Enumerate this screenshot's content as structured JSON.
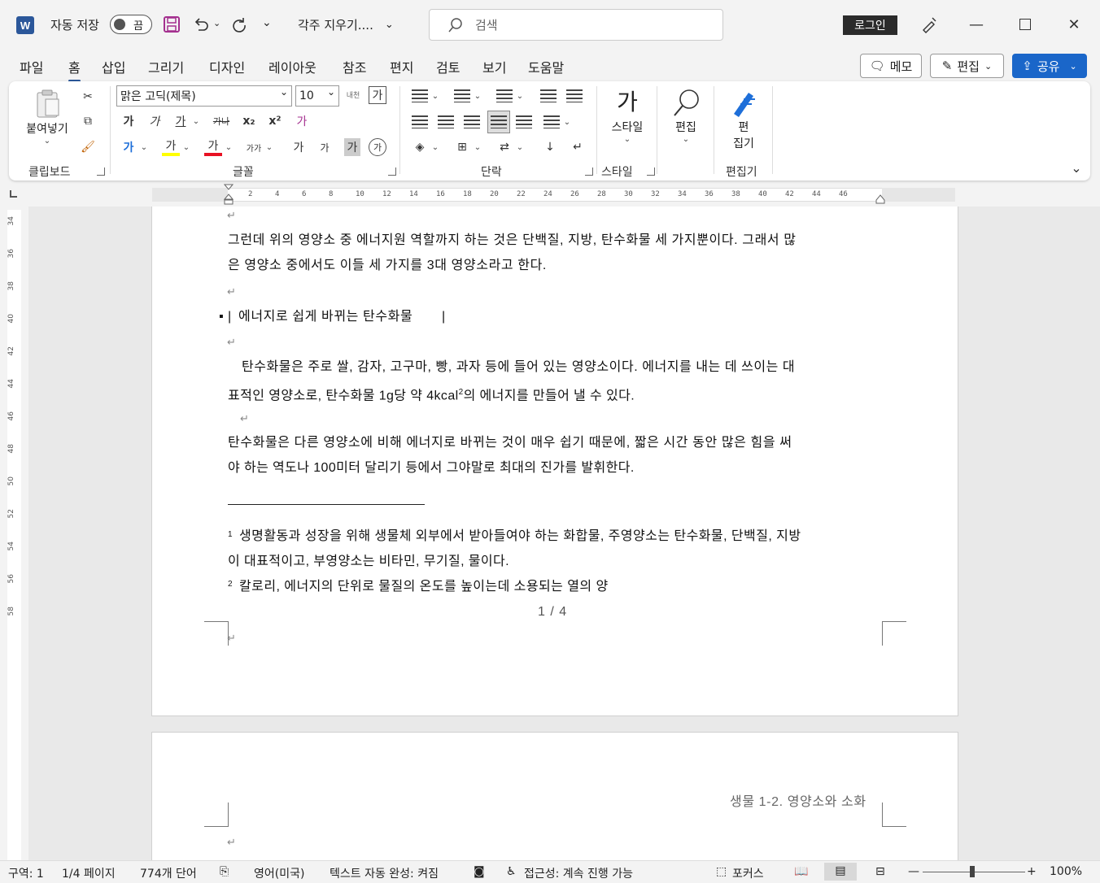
{
  "titlebar": {
    "autosave_label": "자동 저장",
    "autosave_state": "끔",
    "document_title": "각주 지우기....",
    "search_placeholder": "검색",
    "login_label": "로그인"
  },
  "menu": {
    "tabs": [
      "파일",
      "홈",
      "삽입",
      "그리기",
      "디자인",
      "레이아웃",
      "참조",
      "편지",
      "검토",
      "보기",
      "도움말"
    ],
    "active_tab": "홈",
    "memo_label": "메모",
    "edit_label": "편집",
    "share_label": "공유"
  },
  "ribbon": {
    "clipboard": {
      "paste_label": "붙여넣기",
      "group_label": "클립보드"
    },
    "font": {
      "font_name": "맑은 고딕(제목)",
      "font_size": "10",
      "phonetic_label": "내천",
      "char_label": "가",
      "bold": "가",
      "italic": "가",
      "underline": "가",
      "strike": "가나",
      "subscript": "x₂",
      "superscript": "x²",
      "clear_format": "가",
      "text_effect": "가",
      "highlight": "가",
      "font_color": "가",
      "char_spacing": "가가",
      "grow": "가",
      "shrink": "가",
      "shading": "가",
      "enclose": "가",
      "group_label": "글꼴"
    },
    "paragraph": {
      "group_label": "단락"
    },
    "styles": {
      "button_label": "스타일",
      "button_glyph": "가",
      "group_label": "스타일"
    },
    "editing": {
      "button_label": "편집"
    },
    "editor": {
      "button_label_1": "편",
      "button_label_2": "집기",
      "group_label": "편집기"
    }
  },
  "ruler": {
    "h_ticks": [
      "2",
      "4",
      "6",
      "8",
      "10",
      "12",
      "14",
      "16",
      "18",
      "20",
      "22",
      "24",
      "26",
      "28",
      "30",
      "32",
      "34",
      "36",
      "38",
      "40",
      "42",
      "44",
      "46"
    ],
    "v_ticks": [
      "34",
      "36",
      "38",
      "40",
      "42",
      "44",
      "46",
      "48",
      "50",
      "52",
      "54",
      "56",
      "58"
    ]
  },
  "document": {
    "para1_line1": "그런데 위의 영양소 중 에너지원 역할까지 하는 것은 단백질, 지방, 탄수화물 세 가지뿐이다. 그래서 많",
    "para1_line2": "은 영양소 중에서도 이들 세 가지를 3대 영양소라고 한다.",
    "heading": "에너지로 쉽게 바뀌는 탄수화물",
    "para2_line1": "탄수화물은 주로 쌀, 감자, 고구마, 빵, 과자 등에 들어 있는 영양소이다. 에너지를 내는 데 쓰이는 대",
    "para2_line2a": "표적인 영양소로, 탄수화물 1g당 약 4kcal",
    "para2_sup": "2",
    "para2_line2b": "의 에너지를 만들어 낼 수 있다.",
    "para3_line1": "탄수화물은 다른 영양소에 비해 에너지로 바뀌는 것이 매우 쉽기 때문에, 짧은 시간 동안 많은 힘을 써",
    "para3_line2": "야 하는 역도나 100미터 달리기 등에서 그야말로 최대의 진가를 발휘한다.",
    "footnote1_num": "1",
    "footnote1_line1": "생명활동과 성장을 위해 생물체 외부에서 받아들여야 하는 화합물, 주영양소는 탄수화물, 단백질, 지방",
    "footnote1_line2": "이 대표적이고, 부영양소는 비타민, 무기질, 물이다.",
    "footnote2_num": "2",
    "footnote2_text": "칼로리, 에너지의 단위로 물질의 온도를 높이는데 소용되는 열의 양",
    "page_number": "1 / 4",
    "page2_header": "생물 1-2. 영양소와 소화"
  },
  "statusbar": {
    "section": "구역: 1",
    "page": "1/4 페이지",
    "words": "774개 단어",
    "language": "영어(미국)",
    "autocomplete": "텍스트 자동 완성: 켜짐",
    "accessibility": "접근성: 계속 진행 가능",
    "focus": "포커스",
    "zoom": "100%"
  },
  "colors": {
    "accent": "#2b579a",
    "share": "#1a66c9",
    "highlight": "#ffff00",
    "font_color": "#e81123",
    "text_effect": "#1e6fd9"
  }
}
